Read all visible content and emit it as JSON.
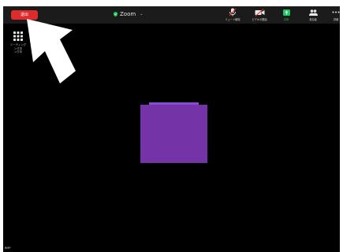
{
  "toolbar": {
    "leave_label": "退出",
    "title": "Zoom",
    "items": [
      {
        "id": "mute",
        "label": "ミュート解除"
      },
      {
        "id": "video",
        "label": "ビデオの開始"
      },
      {
        "id": "share",
        "label": "共有"
      },
      {
        "id": "participants",
        "label": "参加者"
      },
      {
        "id": "more",
        "label": "詳細"
      }
    ]
  },
  "apps": {
    "label_line1": "ミーティング",
    "label_line2": "ング中",
    "label_line3": "ング中"
  },
  "colors": {
    "leave": "#e02b2b",
    "share": "#22c55e",
    "tile": "#7434a8",
    "shield": "#22c55e"
  },
  "icons": [
    "shield-icon",
    "chevron-down-icon",
    "microphone-muted-icon",
    "video-off-icon",
    "share-screen-icon",
    "participants-icon",
    "more-icon",
    "apps-grid-icon",
    "pointer-arrow-icon"
  ],
  "corner_label": "BMP"
}
